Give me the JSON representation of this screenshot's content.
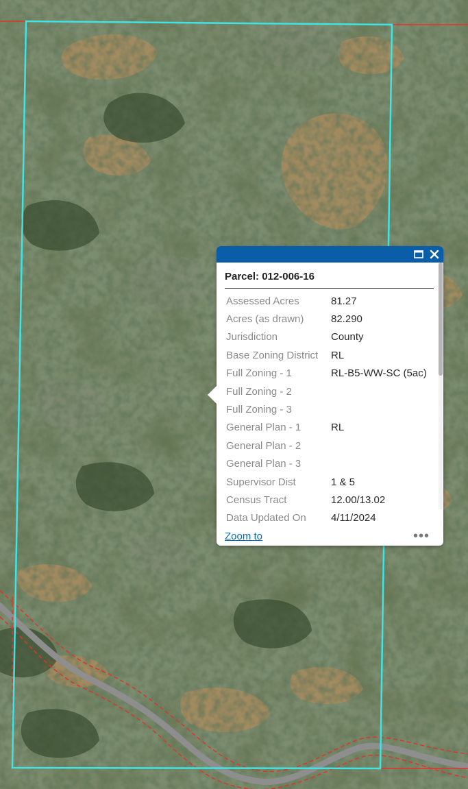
{
  "map": {
    "basemap": "satellite-imagery",
    "parcel_outline_color": "#3fe4e4",
    "neighbor_parcel_color": "#e0342a"
  },
  "popup": {
    "title": "Parcel: 012-006-16",
    "header_color": "#0a5ea8",
    "maximize_icon": "maximize-icon",
    "close_icon": "close-icon",
    "attributes": [
      {
        "key": "Assessed Acres",
        "value": "81.27"
      },
      {
        "key": "Acres (as drawn)",
        "value": "82.290"
      },
      {
        "key": "Jurisdiction",
        "value": "County"
      },
      {
        "key": "Base Zoning District",
        "value": "RL"
      },
      {
        "key": "Full Zoning - 1",
        "value": "RL-B5-WW-SC (5ac)"
      },
      {
        "key": "Full Zoning - 2",
        "value": ""
      },
      {
        "key": "Full Zoning - 3",
        "value": ""
      },
      {
        "key": "General Plan - 1",
        "value": "RL"
      },
      {
        "key": "General Plan - 2",
        "value": ""
      },
      {
        "key": "General Plan - 3",
        "value": ""
      },
      {
        "key": "Supervisor Dist",
        "value": "1 & 5"
      },
      {
        "key": "Census Tract",
        "value": "12.00/13.02"
      },
      {
        "key": "Data Updated On",
        "value": "4/11/2024"
      }
    ],
    "zoom_to_label": "Zoom to",
    "more_icon": "more-options-icon"
  }
}
